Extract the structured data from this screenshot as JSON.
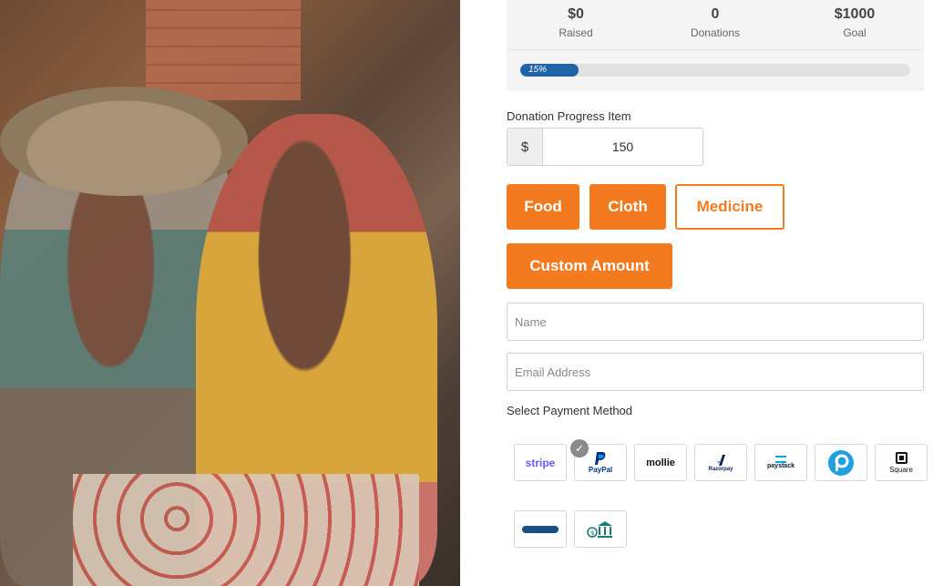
{
  "stats": [
    {
      "value": "$0",
      "label": "Raised"
    },
    {
      "value": "0",
      "label": "Donations"
    },
    {
      "value": "$1000",
      "label": "Goal"
    }
  ],
  "progress": {
    "percent": 15,
    "text": "15%"
  },
  "donation_item": {
    "label": "Donation Progress Item",
    "currency": "$",
    "amount": "150"
  },
  "items": [
    {
      "label": "Food"
    },
    {
      "label": "Cloth"
    },
    {
      "label": "Medicine"
    },
    {
      "label": "Custom Amount"
    }
  ],
  "form": {
    "name_placeholder": "Name",
    "email_placeholder": "Email Address"
  },
  "payment": {
    "label": "Select Payment Method",
    "methods": [
      {
        "name": "stripe",
        "text": "stripe",
        "color": "#635bff"
      },
      {
        "name": "paypal",
        "text": "PayPal",
        "color": "#003087",
        "selected": true
      },
      {
        "name": "mollie",
        "text": "mollie",
        "color": "#111111"
      },
      {
        "name": "razorpay",
        "text": "Razorpay",
        "color": "#0c2451"
      },
      {
        "name": "paystack",
        "text": "paystack",
        "color": "#0aa5db"
      },
      {
        "name": "pcloud-p",
        "text": "",
        "color": "#1fa0e0"
      },
      {
        "name": "square",
        "text": "Square",
        "color": "#111111"
      },
      {
        "name": "paymaster",
        "text": "",
        "color": "#1a4e86"
      },
      {
        "name": "bank",
        "text": "",
        "color": "#1a7a74"
      }
    ]
  },
  "colors": {
    "accent": "#f47a1f",
    "progress": "#1f63a8"
  }
}
